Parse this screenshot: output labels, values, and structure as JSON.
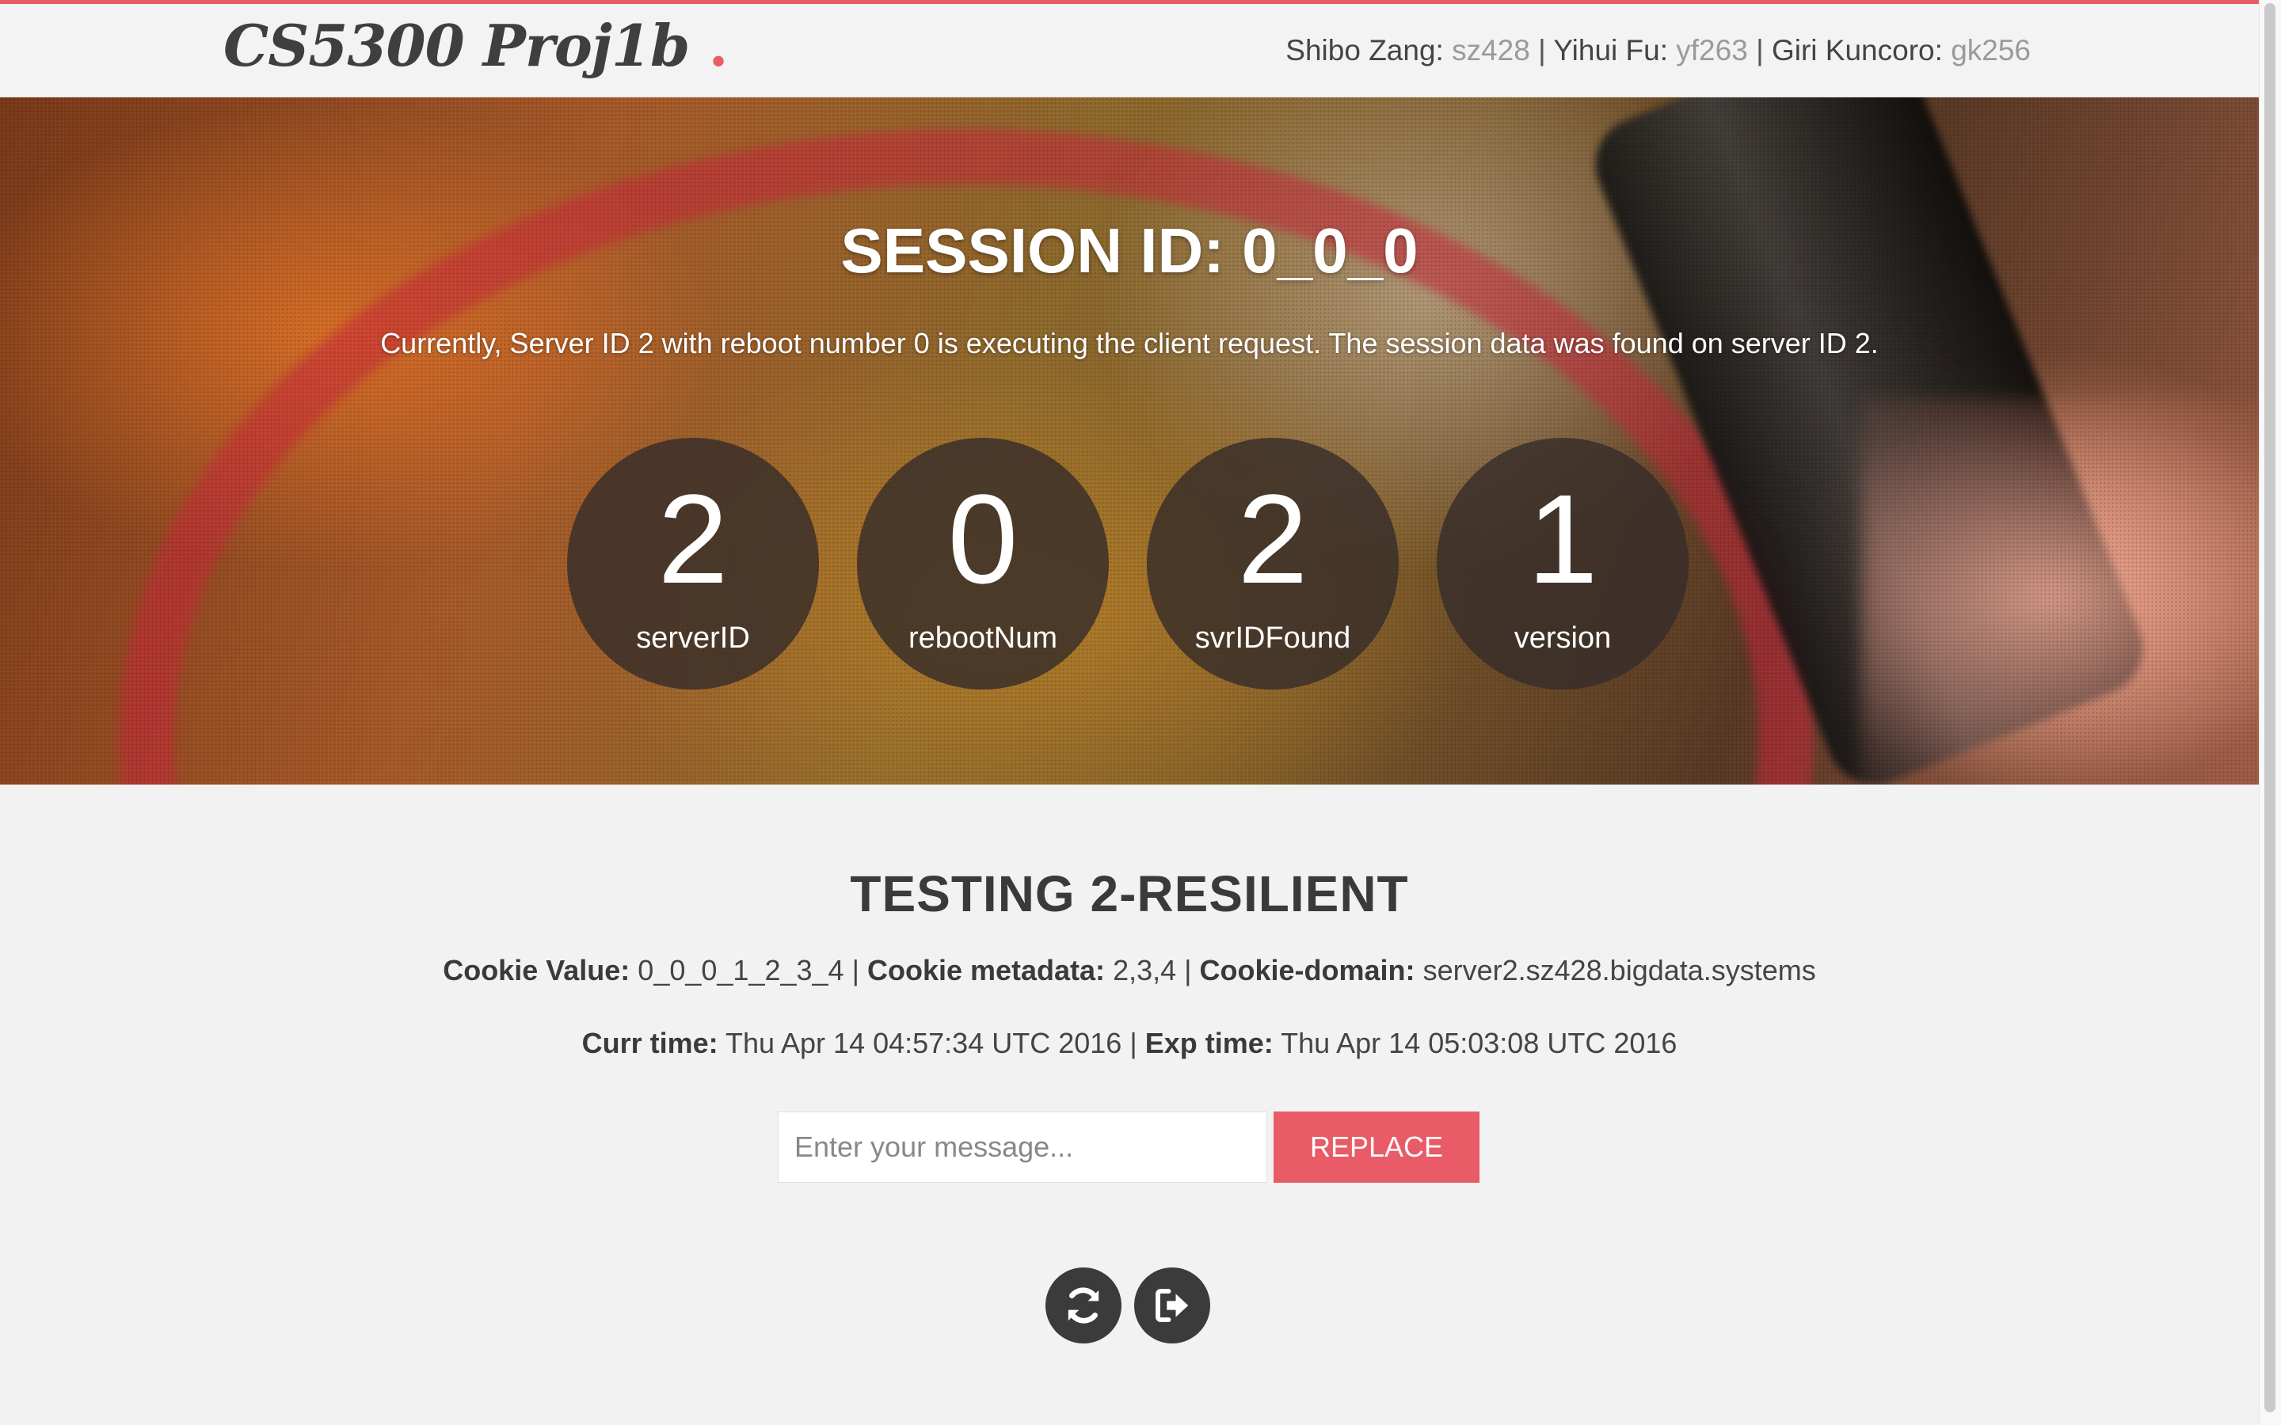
{
  "brand": {
    "name": "CS5300 Proj1b",
    "dot": "."
  },
  "authors": [
    {
      "name": "Shibo Zang:",
      "netid": "sz428"
    },
    {
      "name": "Yihui Fu:",
      "netid": "yf263"
    },
    {
      "name": "Giri Kuncoro:",
      "netid": "gk256"
    }
  ],
  "separator": "|",
  "hero": {
    "title": "SESSION ID: 0_0_0",
    "description": "Currently, Server ID 2 with reboot number 0 is executing the client request. The session data was found on server ID 2.",
    "stats": [
      {
        "value": "2",
        "label": "serverID"
      },
      {
        "value": "0",
        "label": "rebootNum"
      },
      {
        "value": "2",
        "label": "svrIDFound"
      },
      {
        "value": "1",
        "label": "version"
      }
    ]
  },
  "testing": {
    "title": "TESTING 2-RESILIENT",
    "cookie_value_label": "Cookie Value:",
    "cookie_value": "0_0_0_1_2_3_4",
    "cookie_metadata_label": "Cookie metadata:",
    "cookie_metadata": "2,3,4",
    "cookie_domain_label": "Cookie-domain:",
    "cookie_domain": "server2.sz428.bigdata.systems",
    "curr_time_label": "Curr time:",
    "curr_time": "Thu Apr 14 04:57:34 UTC 2016",
    "exp_time_label": "Exp time:",
    "exp_time": "Thu Apr 14 05:03:08 UTC 2016"
  },
  "form": {
    "placeholder": "Enter your message...",
    "value": "",
    "replace_label": "REPLACE"
  },
  "actions": [
    {
      "icon": "refresh-icon"
    },
    {
      "icon": "logout-icon"
    }
  ],
  "colors": {
    "accent": "#e85b67",
    "dark": "#3b3b3b",
    "background": "#f2f2f2"
  }
}
